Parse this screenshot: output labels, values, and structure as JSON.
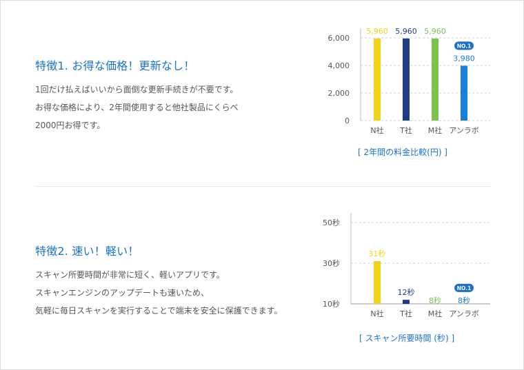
{
  "features": [
    {
      "title": "特徴1. お得な価格！更新なし！",
      "lines": [
        "1回だけ払えばいいから面倒な更新手続きが不要です。",
        "お得な価格により、2年間使用すると他社製品にくらべ",
        "2000円お得です。"
      ]
    },
    {
      "title": "特徴2. 速い！軽い！",
      "lines": [
        "スキャン所要時間が非常に短く、軽いアプリです。",
        "スキャンエンジンのアップデートも速いため、",
        "気軽に毎日スキャンを実行することで端末を安全に保護できます。"
      ]
    }
  ],
  "badge_label": "NO.1",
  "chart_data": [
    {
      "type": "bar",
      "categories": [
        "N社",
        "T社",
        "M社",
        "アンラボ"
      ],
      "values": [
        5960,
        5960,
        5960,
        3980
      ],
      "value_labels": [
        "5,960",
        "5,960",
        "5,960",
        "3,980"
      ],
      "yticks": [
        0,
        2000,
        4000,
        6000
      ],
      "ytick_labels": [
        "0",
        "2,000",
        "4,000",
        "6,000"
      ],
      "ylim": [
        0,
        6000
      ],
      "caption": "[ 2年間の料金比較(円) ]",
      "colors": [
        "#f2d31b",
        "#1f3b87",
        "#7dc24f",
        "#1a7fd9"
      ],
      "grid": true,
      "highlight_index": 3
    },
    {
      "type": "bar",
      "categories": [
        "N社",
        "T社",
        "M社",
        "アンラボ"
      ],
      "values": [
        31,
        12,
        8,
        8
      ],
      "value_labels": [
        "31秒",
        "12秒",
        "8秒",
        "8秒"
      ],
      "yticks": [
        10,
        30,
        50
      ],
      "ytick_labels": [
        "10秒",
        "30秒",
        "50秒"
      ],
      "ylim": [
        10,
        50
      ],
      "caption": "[ スキャン所要時間 (秒) ]",
      "colors": [
        "#f2d31b",
        "#1f3b87",
        "#7dc24f",
        "#1a7fd9"
      ],
      "grid": true,
      "highlight_index": 3
    }
  ]
}
